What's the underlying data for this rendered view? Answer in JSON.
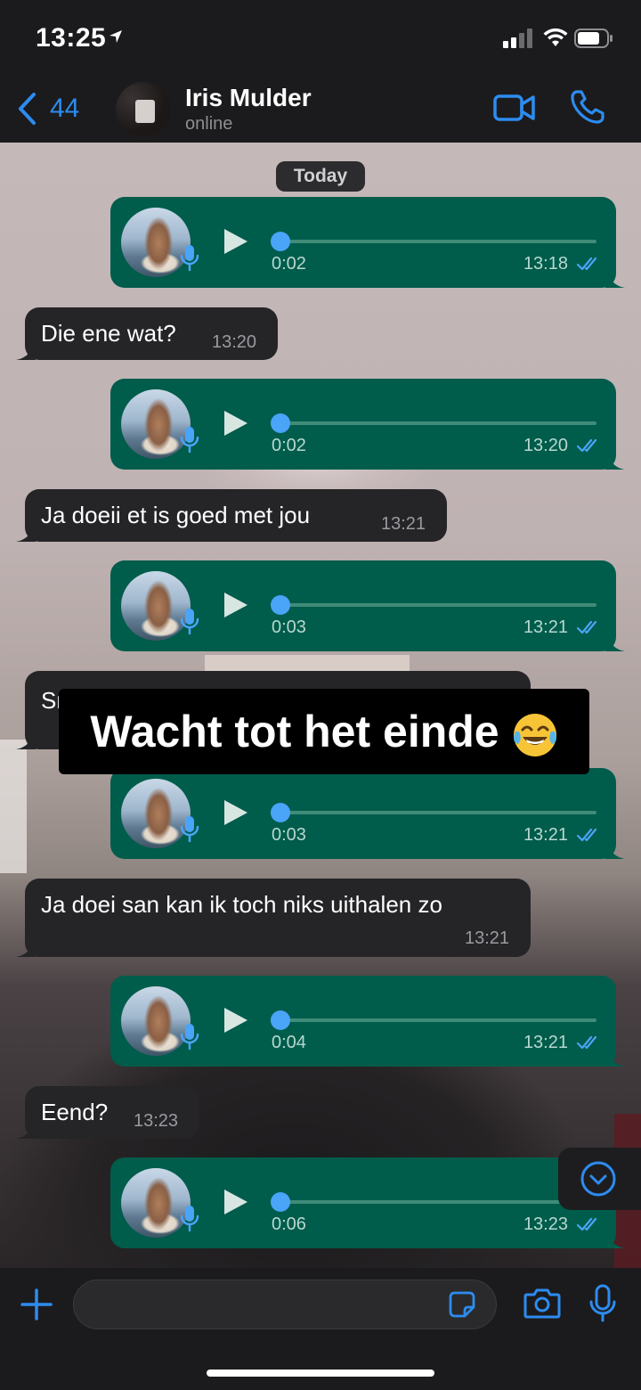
{
  "status_bar": {
    "time": "13:25"
  },
  "header": {
    "back_count": "44",
    "contact_name": "Iris Mulder",
    "contact_status": "online"
  },
  "date_divider": "Today",
  "messages": [
    {
      "type": "voice",
      "direction": "outgoing",
      "duration": "0:02",
      "time": "13:18"
    },
    {
      "type": "text",
      "direction": "incoming",
      "text": "Die ene wat?",
      "time": "13:20"
    },
    {
      "type": "voice",
      "direction": "outgoing",
      "duration": "0:02",
      "time": "13:20"
    },
    {
      "type": "text",
      "direction": "incoming",
      "text": "Ja doeii et is goed met jou",
      "time": "13:21"
    },
    {
      "type": "voice",
      "direction": "outgoing",
      "duration": "0:03",
      "time": "13:21"
    },
    {
      "type": "text",
      "direction": "incoming",
      "text": "Sr",
      "time": ""
    },
    {
      "type": "voice",
      "direction": "outgoing",
      "duration": "0:03",
      "time": "13:21"
    },
    {
      "type": "text",
      "direction": "incoming",
      "text": "Ja doei san kan ik toch niks uithalen zo",
      "time": "13:21"
    },
    {
      "type": "voice",
      "direction": "outgoing",
      "duration": "0:04",
      "time": "13:21"
    },
    {
      "type": "text",
      "direction": "incoming",
      "text": "Eend?",
      "time": "13:23"
    },
    {
      "type": "voice",
      "direction": "outgoing",
      "duration": "0:06",
      "time": "13:23"
    }
  ],
  "overlay_caption": "Wacht tot het einde",
  "overlay_emoji": "face-with-tears-of-joy",
  "input": {
    "placeholder": ""
  },
  "colors": {
    "accent": "#2d8cf0",
    "outgoing_bubble": "#005c4b",
    "incoming_bubble": "#252427",
    "read_ticks": "#4aa4f8"
  }
}
